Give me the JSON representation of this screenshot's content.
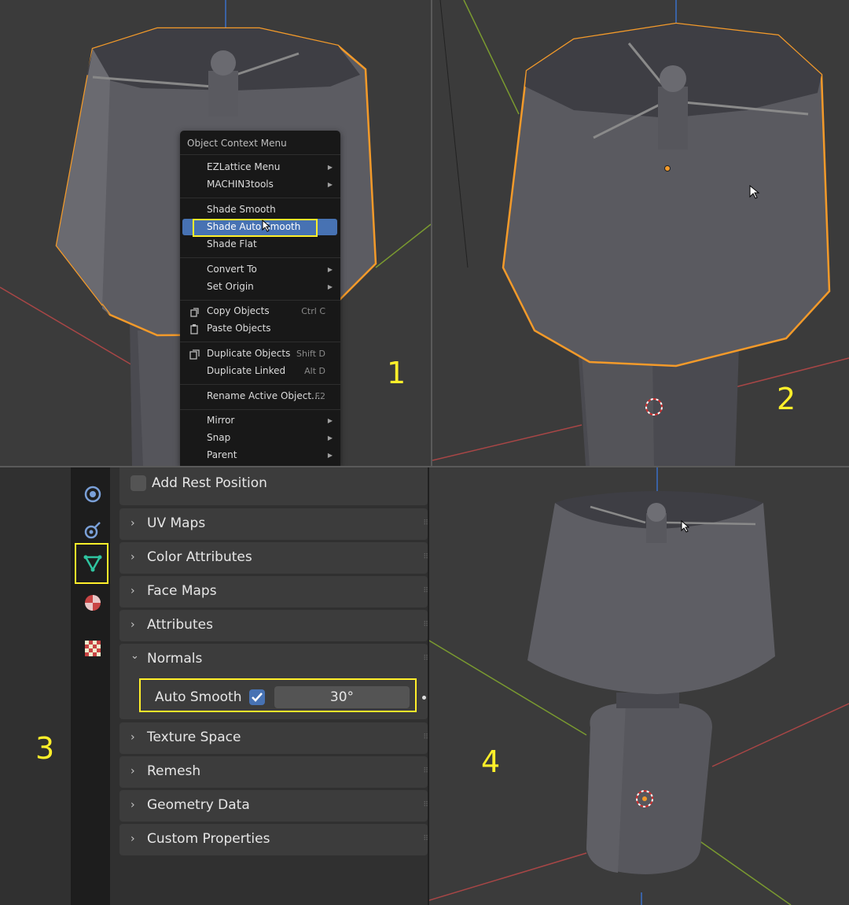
{
  "panels": {
    "p1": {
      "label": "1"
    },
    "p2": {
      "label": "2"
    },
    "p3": {
      "label": "3"
    },
    "p4": {
      "label": "4"
    }
  },
  "context_menu": {
    "title": "Object Context Menu",
    "items": {
      "ezlattice": {
        "label": "EZLattice Menu"
      },
      "machin3": {
        "label": "MACHIN3tools"
      },
      "shade_smooth": {
        "label": "Shade Smooth"
      },
      "shade_auto_smooth": {
        "label": "Shade Auto Smooth"
      },
      "shade_flat": {
        "label": "Shade Flat"
      },
      "convert_to": {
        "label": "Convert To"
      },
      "set_origin": {
        "label": "Set Origin"
      },
      "copy_objects": {
        "label": "Copy Objects",
        "shortcut": "Ctrl C"
      },
      "paste_objects": {
        "label": "Paste Objects"
      },
      "duplicate_objects": {
        "label": "Duplicate Objects",
        "shortcut": "Shift D"
      },
      "duplicate_linked": {
        "label": "Duplicate Linked",
        "shortcut": "Alt D"
      },
      "rename_active": {
        "label": "Rename Active Object...",
        "shortcut": "F2"
      },
      "mirror": {
        "label": "Mirror"
      },
      "snap": {
        "label": "Snap"
      },
      "parent": {
        "label": "Parent"
      }
    }
  },
  "properties": {
    "add_rest_position": "Add Rest Position",
    "sections": {
      "uv_maps": "UV Maps",
      "color_attributes": "Color Attributes",
      "face_maps": "Face Maps",
      "attributes": "Attributes",
      "normals": "Normals",
      "texture_space": "Texture Space",
      "remesh": "Remesh",
      "geometry_data": "Geometry Data",
      "custom_properties": "Custom Properties"
    },
    "auto_smooth": {
      "label": "Auto Smooth",
      "checked": true,
      "angle": "30°"
    }
  },
  "colors": {
    "selection_outline": "#f5a030",
    "highlight": "#4772b3",
    "annotation": "#ffef2a",
    "x_axis": "#b04848",
    "y_axis": "#7a9a30",
    "z_axis": "#3a70c8"
  },
  "icons": {
    "scene": "scene-icon",
    "physics": "physics-icon",
    "mesh_data": "mesh-data-icon",
    "material": "material-icon",
    "texture": "texture-icon"
  }
}
